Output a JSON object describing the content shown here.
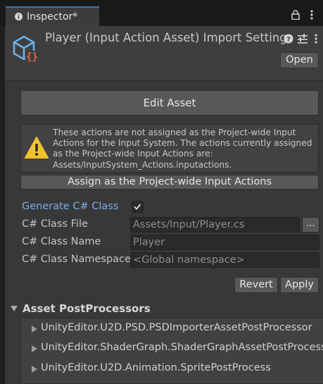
{
  "tab": {
    "title": "Inspector*"
  },
  "header": {
    "title": "Player (Input Action Asset) Import Settings",
    "open_label": "Open"
  },
  "edit_asset_label": "Edit Asset",
  "warning": {
    "text": "These actions are not assigned as the Project-wide Input Actions for the Input System.  The actions currently assigned as the Project-wide Input Actions are: Assets/InputSystem_Actions.inputactions."
  },
  "assign_label": "Assign as the Project-wide Input Actions",
  "generate": {
    "label": "Generate C# Class",
    "checked": true
  },
  "class_file": {
    "label": "C# Class File",
    "value": "Assets/Input/Player.cs",
    "browse_label": "..."
  },
  "class_name": {
    "label": "C# Class Name",
    "placeholder": "Player"
  },
  "class_namespace": {
    "label": "C# Class Namespace",
    "placeholder": "<Global namespace>"
  },
  "revert_label": "Revert",
  "apply_label": "Apply",
  "postprocessors": {
    "title": "Asset PostProcessors",
    "items": [
      {
        "label": "UnityEditor.U2D.PSD.PSDImporterAssetPostProcessor"
      },
      {
        "label": "UnityEditor.ShaderGraph.ShaderGraphAssetPostProcessor"
      },
      {
        "label": "UnityEditor.U2D.Animation.SpritePostProcess"
      }
    ]
  },
  "colors": {
    "accent": "#3a79bb",
    "label_highlight": "#7babe8",
    "warning": "#f2c230",
    "asset_icon": "#6cb2e6",
    "asset_icon_badge": "#e9673f"
  }
}
